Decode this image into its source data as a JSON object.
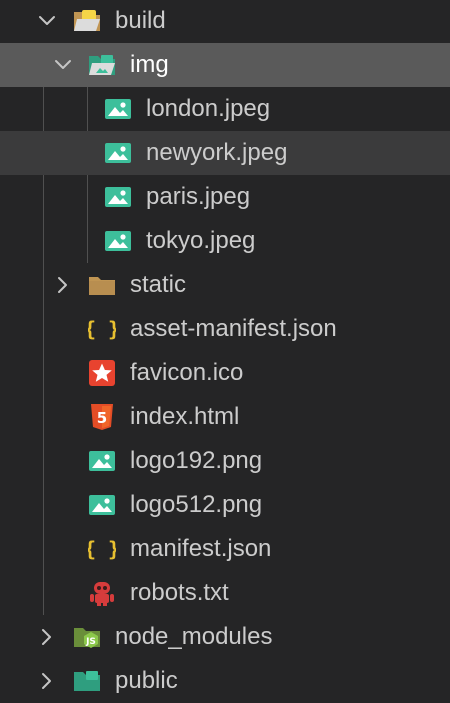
{
  "explorer": {
    "items": [
      {
        "label": "build",
        "icon": "folder-open-icon",
        "depth": 0,
        "expanded": true,
        "has_twisty": true
      },
      {
        "label": "img",
        "icon": "image-folder-open-icon",
        "depth": 1,
        "expanded": true,
        "has_twisty": true,
        "selected": true
      },
      {
        "label": "london.jpeg",
        "icon": "image-file-icon",
        "depth": 2
      },
      {
        "label": "newyork.jpeg",
        "icon": "image-file-icon",
        "depth": 2,
        "hover": true
      },
      {
        "label": "paris.jpeg",
        "icon": "image-file-icon",
        "depth": 2
      },
      {
        "label": "tokyo.jpeg",
        "icon": "image-file-icon",
        "depth": 2
      },
      {
        "label": "static",
        "icon": "folder-icon",
        "depth": 1,
        "expanded": false,
        "has_twisty": true
      },
      {
        "label": "asset-manifest.json",
        "icon": "json-file-icon",
        "depth": 1
      },
      {
        "label": "favicon.ico",
        "icon": "favicon-file-icon",
        "depth": 1
      },
      {
        "label": "index.html",
        "icon": "html5-file-icon",
        "depth": 1
      },
      {
        "label": "logo192.png",
        "icon": "image-file-icon",
        "depth": 1
      },
      {
        "label": "logo512.png",
        "icon": "image-file-icon",
        "depth": 1
      },
      {
        "label": "manifest.json",
        "icon": "json-file-icon",
        "depth": 1
      },
      {
        "label": "robots.txt",
        "icon": "robot-file-icon",
        "depth": 1
      },
      {
        "label": "node_modules",
        "icon": "node-folder-icon",
        "depth": 0,
        "expanded": false,
        "has_twisty": true
      },
      {
        "label": "public",
        "icon": "public-folder-icon",
        "depth": 0,
        "expanded": false,
        "has_twisty": true
      }
    ]
  },
  "colors": {
    "background": "#252526",
    "selected_row": "#5a5a5a",
    "hover_row": "#3b3b3c",
    "text": "#cccccc",
    "image_icon": "#3dbf9b",
    "json_icon": "#e8c030",
    "html_icon": "#e44d26",
    "favicon_icon": "#e8432f",
    "folder_icon": "#c09553",
    "robot_icon": "#d63c3c",
    "node_icon": "#8cc84b"
  }
}
